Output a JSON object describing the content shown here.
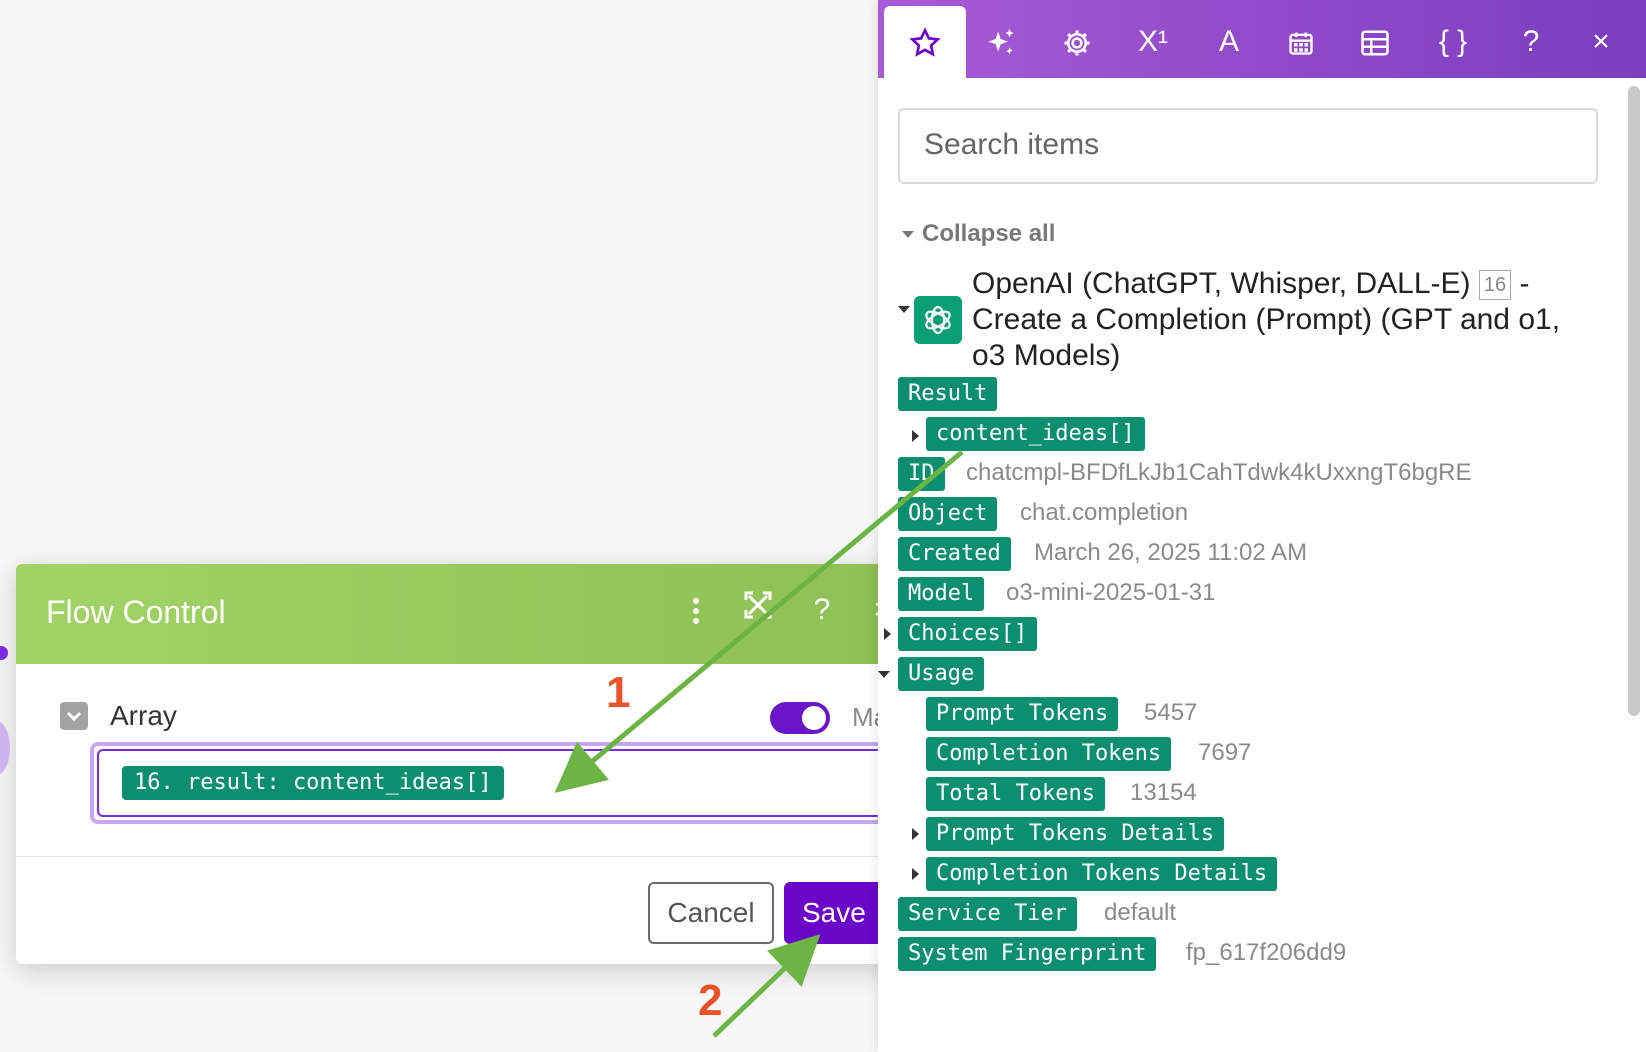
{
  "dialog": {
    "title": "Flow Control",
    "field_label": "Array",
    "map_label": "Map",
    "mapped_value": "16. result: content_ideas[]",
    "cancel_label": "Cancel",
    "save_label": "Save",
    "close_glyph": "×",
    "help_glyph": "?"
  },
  "panel": {
    "tabs": [
      "star-icon",
      "sparkles-icon",
      "gear-icon",
      "superscript-icon",
      "text-icon",
      "calendar-icon",
      "table-icon",
      "braces-icon",
      "help-icon",
      "close-icon"
    ],
    "tab_glyphs": {
      "superscript": "X¹",
      "text": "A",
      "braces": "{ }",
      "help": "?",
      "close": "×"
    },
    "search_placeholder": "Search items",
    "collapse_all": "Collapse all",
    "module": {
      "line1": "OpenAI (ChatGPT, Whisper, DALL-E)",
      "badge": "16",
      "line1_suffix": "-",
      "line2": "Create a Completion (Prompt) (GPT and o1,",
      "line3": "o3 Models)"
    },
    "tree": [
      {
        "key": "Result",
        "value": ""
      },
      {
        "key": "content_ideas[]",
        "value": ""
      },
      {
        "key": "ID",
        "value": "chatcmpl-BFDfLkJb1CahTdwk4kUxxngT6bgRE"
      },
      {
        "key": "Object",
        "value": "chat.completion"
      },
      {
        "key": "Created",
        "value": "March 26, 2025 11:02 AM"
      },
      {
        "key": "Model",
        "value": "o3-mini-2025-01-31"
      },
      {
        "key": "Choices[]",
        "value": ""
      },
      {
        "key": "Usage",
        "value": ""
      },
      {
        "key": "Prompt Tokens",
        "value": "5457"
      },
      {
        "key": "Completion Tokens",
        "value": "7697"
      },
      {
        "key": "Total Tokens",
        "value": "13154"
      },
      {
        "key": "Prompt Tokens Details",
        "value": ""
      },
      {
        "key": "Completion Tokens Details",
        "value": ""
      },
      {
        "key": "Service Tier",
        "value": "default"
      },
      {
        "key": "System Fingerprint",
        "value": "fp_617f206dd9"
      }
    ]
  },
  "annotations": {
    "step1": "1",
    "step2": "2",
    "arrow_color": "#6cb545"
  },
  "colors": {
    "brand_purple": "#6a07c8",
    "pill_green": "#0c8f71",
    "header_green": "#94c75a"
  }
}
